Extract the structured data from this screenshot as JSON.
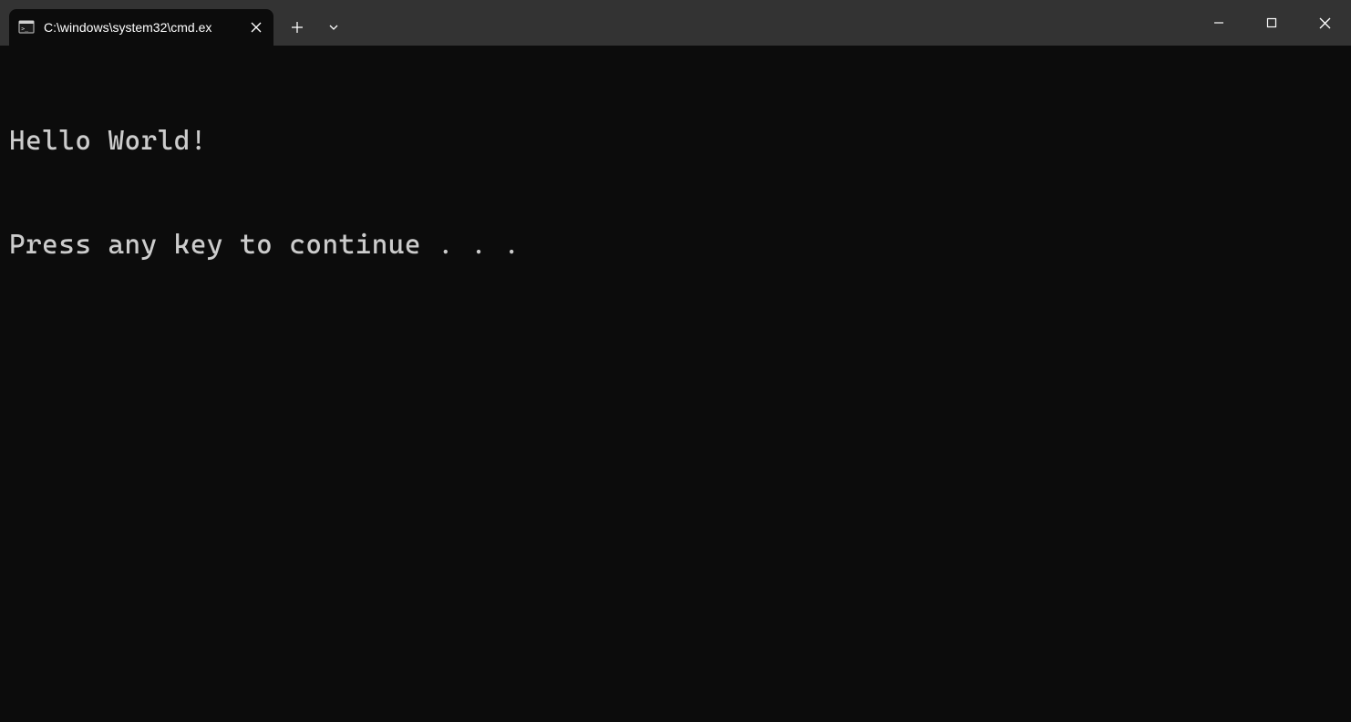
{
  "tab": {
    "title": "C:\\windows\\system32\\cmd.ex",
    "icon": "cmd-icon"
  },
  "output": {
    "lines": [
      "Hello World!",
      "Press any key to continue . . ."
    ]
  }
}
